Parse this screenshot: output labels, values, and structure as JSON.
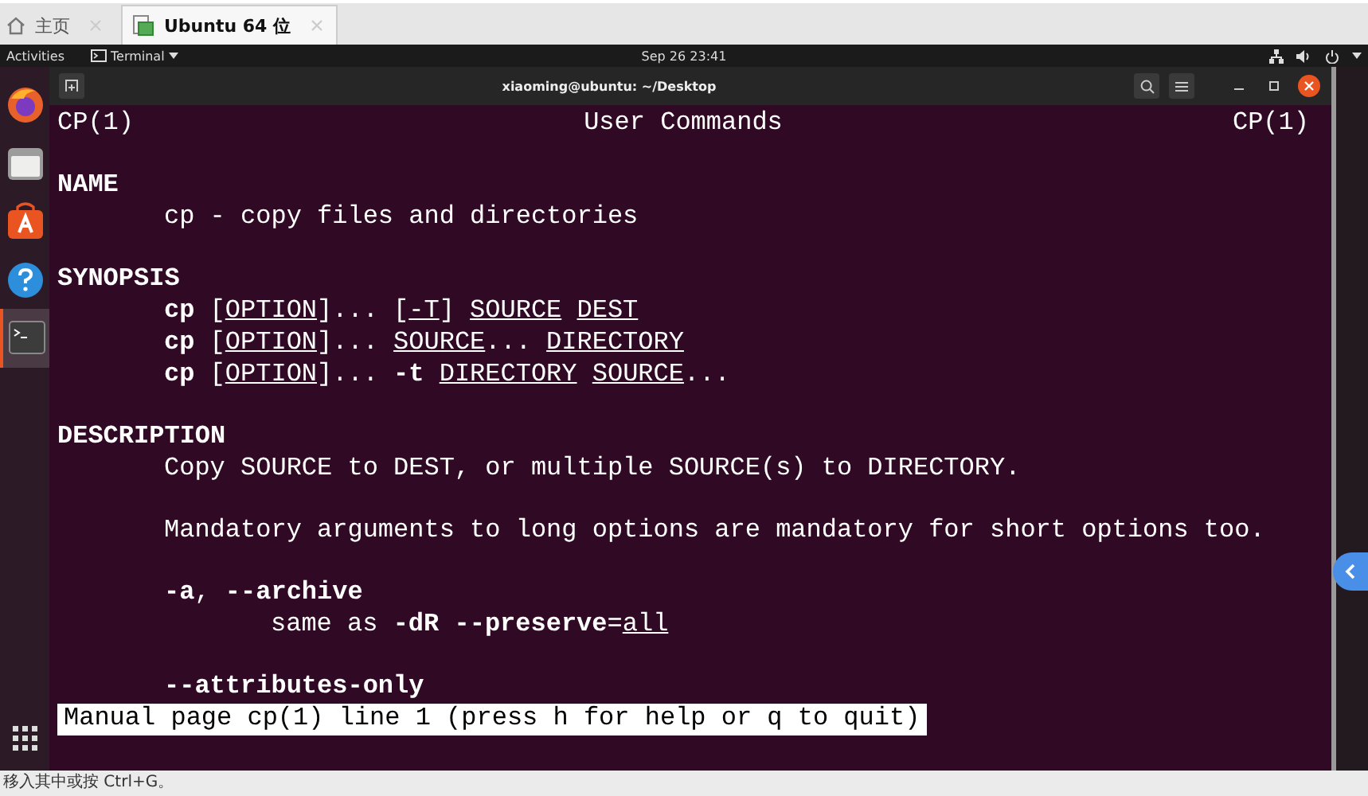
{
  "browser_tabs": [
    {
      "label": "主页",
      "selected": false
    },
    {
      "label": "Ubuntu 64 位",
      "selected": true
    }
  ],
  "top_bar": {
    "activities": "Activities",
    "app_menu": "Terminal",
    "clock": "Sep 26 23:41"
  },
  "dock": {
    "items": [
      {
        "kind": "browser",
        "selected": false
      },
      {
        "kind": "files",
        "selected": false
      },
      {
        "kind": "store",
        "selected": false
      },
      {
        "kind": "help",
        "selected": false
      },
      {
        "kind": "terminal",
        "selected": true
      }
    ]
  },
  "terminal": {
    "title": "xiaoming@ubuntu: ~/Desktop",
    "header": {
      "left": "CP(1)",
      "center": "User Commands",
      "right": "CP(1)"
    },
    "lines": [
      {
        "kind": "blank"
      },
      {
        "kind": "section",
        "text": "NAME"
      },
      {
        "kind": "text",
        "text": "cp - copy files and directories"
      },
      {
        "kind": "blank"
      },
      {
        "kind": "section",
        "text": "SYNOPSIS"
      },
      {
        "kind": "text",
        "text": "**cp** [*OPTION*]... [*-T*] *SOURCE* *DEST*"
      },
      {
        "kind": "text",
        "text": "**cp** [*OPTION*]... *SOURCE*... *DIRECTORY*"
      },
      {
        "kind": "text",
        "text": "**cp** [*OPTION*]... **-t** *DIRECTORY* *SOURCE*..."
      },
      {
        "kind": "blank"
      },
      {
        "kind": "section",
        "text": "DESCRIPTION"
      },
      {
        "kind": "text",
        "text": "Copy SOURCE to DEST, or multiple SOURCE(s) to DIRECTORY."
      },
      {
        "kind": "blank"
      },
      {
        "kind": "text",
        "text": "Mandatory arguments to long options are mandatory for short options too."
      },
      {
        "kind": "blank"
      },
      {
        "kind": "text",
        "text": "**-a**, **--archive**"
      },
      {
        "kind": "subtext",
        "text": "same as **-dR** **--preserve**=*all*"
      },
      {
        "kind": "blank"
      },
      {
        "kind": "option",
        "text": "--attributes-only"
      }
    ],
    "status": "Manual page cp(1) line 1 (press h for help or q to quit)"
  },
  "status_bar": "移入其中或按 Ctrl+G。"
}
